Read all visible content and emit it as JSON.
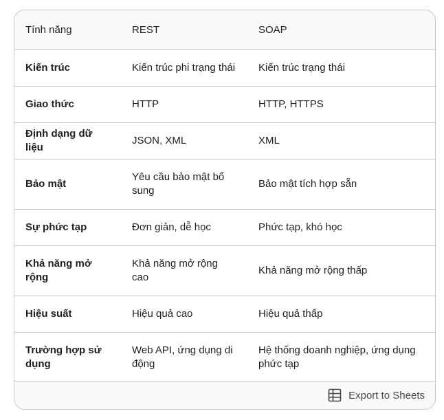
{
  "table": {
    "headers": [
      "Tính năng",
      "REST",
      "SOAP"
    ],
    "rows": [
      [
        "Kiến trúc",
        "Kiến trúc phi trạng thái",
        "Kiến trúc trạng thái"
      ],
      [
        "Giao thức",
        "HTTP",
        "HTTP, HTTPS"
      ],
      [
        "Định dạng dữ liệu",
        "JSON, XML",
        "XML"
      ],
      [
        "Bảo mật",
        "Yêu cầu bảo mật bổ sung",
        "Bảo mật tích hợp sẵn"
      ],
      [
        "Sự phức tạp",
        "Đơn giản, dễ học",
        "Phức tạp, khó học"
      ],
      [
        "Khả năng mở rộng",
        "Khả năng mở rộng cao",
        "Khả năng mở rộng thấp"
      ],
      [
        "Hiệu suất",
        "Hiệu quả cao",
        "Hiệu quả thấp"
      ],
      [
        "Trường hợp sử dụng",
        "Web API, ứng dụng di động",
        "Hệ thống doanh nghiệp, ứng dụng phức tạp"
      ]
    ]
  },
  "footer": {
    "export_label": "Export to Sheets",
    "export_icon": "sheets-table-icon"
  }
}
